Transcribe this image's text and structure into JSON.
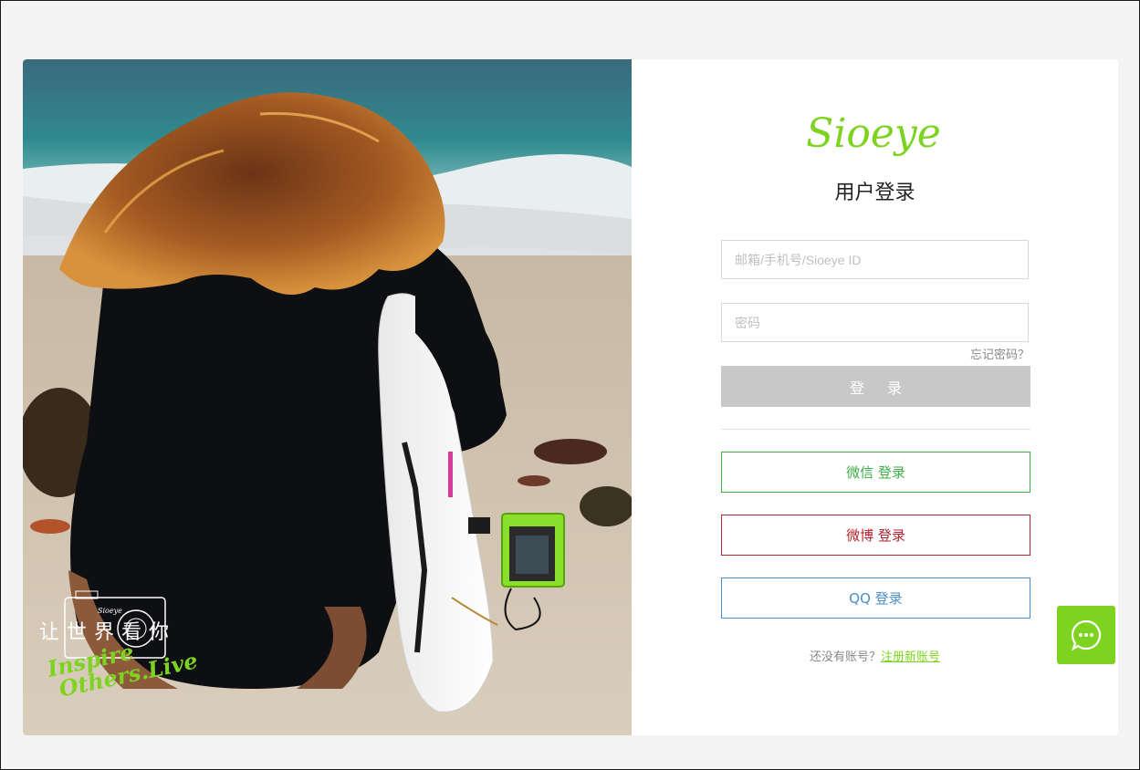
{
  "photo": {
    "slogan_cn": "让世界看你",
    "slogan_en_line1": "Inspire",
    "slogan_en_line2": "Others.Live",
    "mini_logo": "Sioeye"
  },
  "login": {
    "logo_text": "Sioeye",
    "title": "用户登录",
    "account_placeholder": "邮箱/手机号/Sioeye ID",
    "password_placeholder": "密码",
    "forgot_label": "忘记密码？",
    "login_button": "登 录",
    "wechat_label": "微信 登录",
    "weibo_label": "微博 登录",
    "qq_label": "QQ 登录",
    "register_prompt": "还没有账号？",
    "register_link": "注册新账号"
  },
  "colors": {
    "brand": "#7ed321",
    "wechat": "#3fae49",
    "weibo": "#b2242f",
    "qq": "#4a8fc9",
    "login_disabled": "#c8c8c8"
  },
  "icons": {
    "chat": "chat-bubble-icon"
  }
}
